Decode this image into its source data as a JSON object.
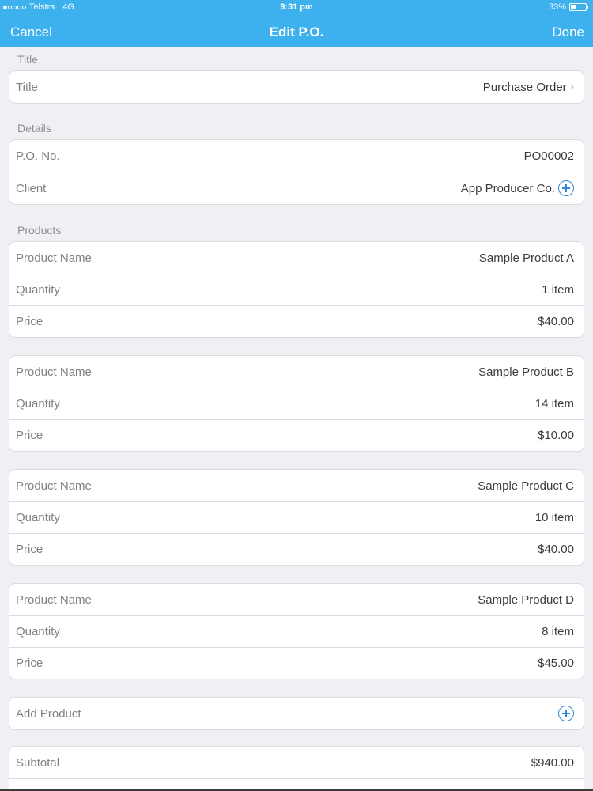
{
  "status_bar": {
    "carrier": "Telstra",
    "network": "4G",
    "time": "9:31 pm",
    "battery": "33%"
  },
  "nav": {
    "cancel_label": "Cancel",
    "title": "Edit P.O.",
    "done_label": "Done"
  },
  "sections": {
    "title_header": "Title",
    "details_header": "Details",
    "products_header": "Products"
  },
  "title_row": {
    "label": "Title",
    "value": "Purchase Order"
  },
  "details": {
    "po_label": "P.O. No.",
    "po_value": "PO00002",
    "client_label": "Client",
    "client_value": "App Producer Co."
  },
  "product_labels": {
    "name": "Product Name",
    "quantity": "Quantity",
    "price": "Price"
  },
  "products": [
    {
      "name": "Sample Product A",
      "quantity": "1 item",
      "price": "$40.00"
    },
    {
      "name": "Sample Product B",
      "quantity": "14 item",
      "price": "$10.00"
    },
    {
      "name": "Sample Product C",
      "quantity": "10 item",
      "price": "$40.00"
    },
    {
      "name": "Sample Product D",
      "quantity": "8 item",
      "price": "$45.00"
    }
  ],
  "add_product_label": "Add Product",
  "totals": {
    "subtotal_label": "Subtotal",
    "subtotal_value": "$940.00"
  },
  "colors": {
    "accent": "#3db0ee",
    "icon_blue": "#2f86d6",
    "background": "#eff0f4"
  }
}
